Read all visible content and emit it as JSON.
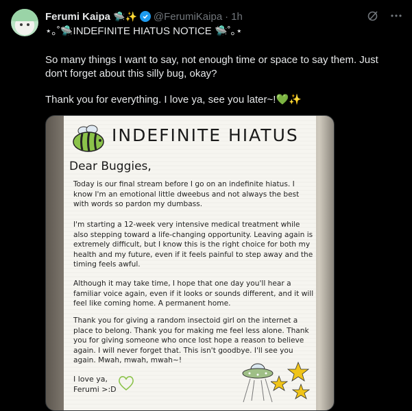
{
  "tweet": {
    "display_name": "Ferumi Kaipa",
    "name_emoji": "🛸✨",
    "handle": "@FerumiKaipa",
    "separator": "·",
    "time": "1h",
    "line1": "⋆｡˚🛸INDEFINITE HIATUS NOTICE 🛸˚｡⋆",
    "para1": "So many things I want to say, not enough time or space to say them. Just don't forget about this silly bug, okay?",
    "para2_text": "Thank you for everything. I love ya, see you later~!",
    "para2_emoji_heart": "💚",
    "para2_emoji_sparkle": "✨"
  },
  "icons": {
    "verified": "verified-badge-icon",
    "grok": "grok-icon",
    "more": "more-icon"
  },
  "colors": {
    "background": "#000000",
    "text": "#e7e9ea",
    "muted": "#71767b",
    "verified": "#1d9bf0",
    "heart": "#4caf50"
  },
  "image": {
    "title": "INDEFINITE HIATUS",
    "greeting": "Dear Buggies,",
    "p1": "Today is our final stream before I go on an indefinite hiatus. I know I'm an emotional little dweebus and not always the best with words so pardon my dumbass.",
    "p2": "I'm starting a 12-week very intensive medical treatment while also stepping toward a life-changing opportunity. Leaving again is extremely difficult, but I know this is the right choice for both my health and my future, even if it feels painful to step away and the timing feels awful.",
    "p3": "Although it may take time, I hope that one day you'll hear a familiar voice again, even if it looks or sounds different, and it will feel like coming home. A permanent home.",
    "p4": "Thank you for giving a random insectoid girl on the internet a place to belong. Thank you for making me feel less alone. Thank you for giving someone who once lost hope a reason to believe again. I will never forget that. This isn't goodbye. I'll see you again. Mwah, mwah, mwah~!",
    "signoff_line1": "I love ya,",
    "signoff_line2": "Ferumi >:D"
  }
}
